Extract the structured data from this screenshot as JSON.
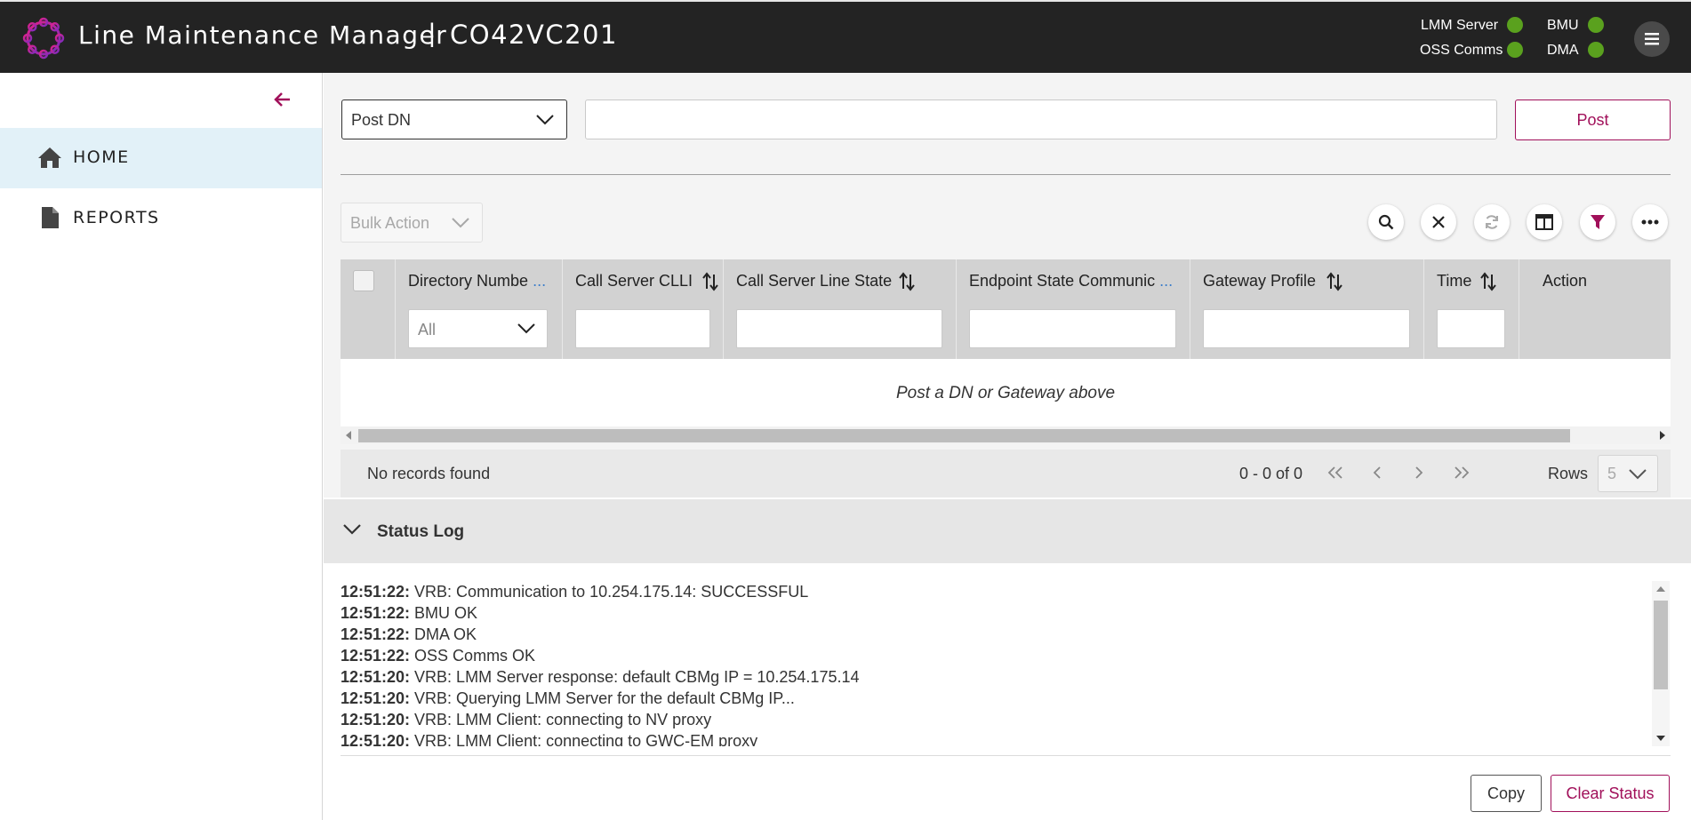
{
  "header": {
    "title": "Line Maintenance Manager",
    "separator": "|",
    "host": "CO42VC201",
    "status": [
      {
        "label": "LMM Server"
      },
      {
        "label": "BMU"
      },
      {
        "label": "OSS Comms"
      },
      {
        "label": "DMA"
      }
    ],
    "status_color": "#5aa11e",
    "accent_color": "#a1105a"
  },
  "sidebar": {
    "items": [
      {
        "label": "HOME",
        "icon": "home-icon",
        "active": true
      },
      {
        "label": "REPORTS",
        "icon": "document-icon",
        "active": false
      }
    ]
  },
  "toolbar": {
    "post_type": "Post DN",
    "post_input_value": "",
    "post_label": "Post",
    "bulk_action": "Bulk Action"
  },
  "table": {
    "columns": [
      {
        "label": "Directory Numbe",
        "filter": "All"
      },
      {
        "label": "Call Server CLLI"
      },
      {
        "label": "Call Server Line State"
      },
      {
        "label": "Endpoint State Communic"
      },
      {
        "label": "Gateway Profile"
      },
      {
        "label": "Time"
      },
      {
        "label": "Action"
      }
    ],
    "ellipsis": "...",
    "empty_message": "Post a DN or Gateway above"
  },
  "pagination": {
    "no_records": "No records found",
    "range": "0 - 0 of 0",
    "rows_label": "Rows",
    "rows_value": "5"
  },
  "status_log": {
    "title": "Status Log",
    "lines": [
      {
        "time": "12:51:22:",
        "msg": " VRB: Communication to 10.254.175.14: SUCCESSFUL"
      },
      {
        "time": "12:51:22:",
        "msg": " BMU OK"
      },
      {
        "time": "12:51:22:",
        "msg": " DMA OK"
      },
      {
        "time": "12:51:22:",
        "msg": " OSS Comms OK"
      },
      {
        "time": "12:51:20:",
        "msg": " VRB: LMM Server response: default CBMg IP = 10.254.175.14"
      },
      {
        "time": "12:51:20:",
        "msg": " VRB: Querying LMM Server for the default CBMg IP..."
      },
      {
        "time": "12:51:20:",
        "msg": " VRB: LMM Client: connecting to NV proxy"
      },
      {
        "time": "12:51:20:",
        "msg": " VRB: LMM Client: connecting to GWC-EM proxy"
      }
    ],
    "copy_label": "Copy",
    "clear_label": "Clear Status"
  }
}
